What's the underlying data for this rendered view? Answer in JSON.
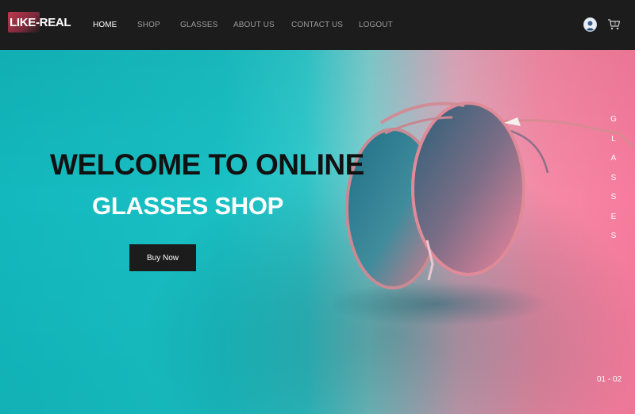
{
  "brand": {
    "logo_text": "LIKE-REAL"
  },
  "nav": {
    "items": [
      {
        "label": "HOME",
        "active": true
      },
      {
        "label": "SHOP",
        "active": false
      },
      {
        "label": "GLASSES",
        "active": false
      },
      {
        "label": "ABOUT US",
        "active": false
      },
      {
        "label": "CONTACT US",
        "active": false
      },
      {
        "label": "LOGOUT",
        "active": false
      }
    ]
  },
  "header_icons": {
    "avatar": "user-avatar-icon",
    "cart": "shopping-cart-icon",
    "cart_count": "0"
  },
  "hero": {
    "title_line1": "WELCOME TO ONLINE",
    "title_line2": "GLASSES SHOP",
    "cta_label": "Buy Now",
    "side_letters": [
      "G",
      "L",
      "A",
      "S",
      "S",
      "E",
      "S"
    ],
    "slide_indicator": "01 - 02",
    "image": "round-sunglasses-photo"
  },
  "colors": {
    "header_bg": "#1c1c1c",
    "nav_active": "#ffffff",
    "nav_inactive": "#9a9a9a",
    "hero_teal": "#12b8bd",
    "hero_pink": "#f77b9c",
    "button_bg": "#1c1c1c"
  }
}
